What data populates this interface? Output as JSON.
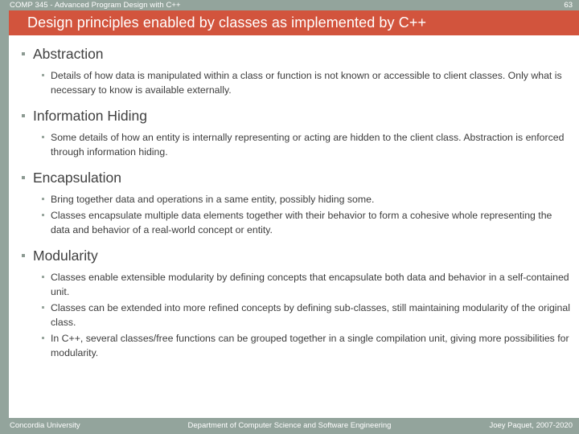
{
  "header": {
    "course": "COMP 345 - Advanced Program Design with C++",
    "page_number": "63"
  },
  "title": "Design principles enabled by classes as implemented by C++",
  "colors": {
    "accent_bar": "#93a49c",
    "title_banner": "#d2543d",
    "background": "#ffffff",
    "level1_text": "#404040",
    "level2_text": "#3c3c3c",
    "bullet": "#8c9a92"
  },
  "sections": [
    {
      "heading": "Abstraction",
      "points": [
        "Details of how data is manipulated within a class or function is not known or accessible to client classes. Only what is necessary to know is available externally."
      ]
    },
    {
      "heading": "Information Hiding",
      "points": [
        "Some details of how an entity is internally representing or acting are hidden to the client class. Abstraction is enforced through information hiding."
      ]
    },
    {
      "heading": "Encapsulation",
      "points": [
        "Bring together data and operations in a same entity, possibly hiding some.",
        "Classes encapsulate multiple data elements together with their behavior to form a cohesive whole representing the data and behavior of a real-world concept or entity."
      ]
    },
    {
      "heading": "Modularity",
      "points": [
        "Classes enable extensible modularity by defining concepts that encapsulate both data and behavior in a self-contained unit.",
        "Classes can be extended into more refined concepts by defining sub-classes, still maintaining modularity of the original class.",
        "In C++, several classes/free functions can be grouped together in a single compilation unit, giving more possibilities for modularity."
      ]
    }
  ],
  "footer": {
    "left": "Concordia University",
    "center": "Department of Computer Science and Software Engineering",
    "right": "Joey Paquet, 2007-2020"
  }
}
